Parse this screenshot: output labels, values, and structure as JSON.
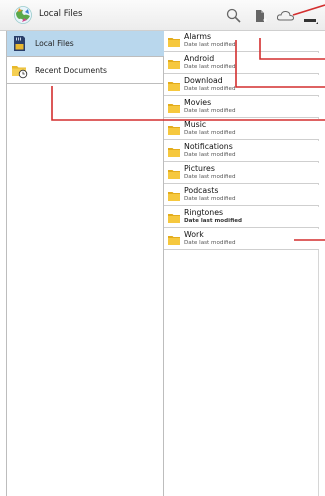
{
  "app": {
    "title": "Local Files",
    "icon": "recycle-globe-icon"
  },
  "actionbar": {
    "search_icon": "search-icon",
    "new_file_icon": "new-document-icon",
    "cloud_icon": "cloud-icon",
    "menu_icon": "overflow-menu-icon"
  },
  "sidebar": {
    "items": [
      {
        "label": "Local Files",
        "icon": "sd-card-icon",
        "selected": true
      },
      {
        "label": "Recent Documents",
        "icon": "recent-folder-icon",
        "selected": false
      }
    ]
  },
  "files": {
    "items": [
      {
        "name": "Alarms",
        "subtitle": "Date last modified"
      },
      {
        "name": "Android",
        "subtitle": "Date last modified"
      },
      {
        "name": "Download",
        "subtitle": "Date last modified"
      },
      {
        "name": "Movies",
        "subtitle": "Date last modified"
      },
      {
        "name": "Music",
        "subtitle": "Date last modified"
      },
      {
        "name": "Notifications",
        "subtitle": "Date last modified"
      },
      {
        "name": "Pictures",
        "subtitle": "Date last modified"
      },
      {
        "name": "Podcasts",
        "subtitle": "Date last modified"
      },
      {
        "name": "Ringtones",
        "subtitle": "Date last modified"
      },
      {
        "name": "Work",
        "subtitle": "Date last modified"
      }
    ]
  },
  "colors": {
    "selected_bg": "#b9d7ed",
    "folder": "#f2c230",
    "annotation_red": "#d32f2f"
  }
}
